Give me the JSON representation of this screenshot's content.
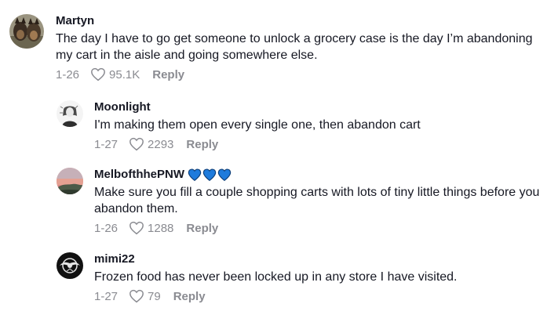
{
  "comments": [
    {
      "username": "Martyn",
      "text": "The day I have to go get someone to unlock a grocery case is the day I’m abandoning my cart in the aisle and going somewhere else.",
      "date": "1-26",
      "likes": "95.1K",
      "reply_label": "Reply",
      "avatar_icon": "photo-avatar-dogs"
    },
    {
      "username": "Moonlight",
      "text": "I'm making them open every single one, then abandon cart",
      "date": "1-27",
      "likes": "2293",
      "reply_label": "Reply",
      "avatar_icon": "sketch-avatar"
    },
    {
      "username": "MelbofthhePNW",
      "username_emoji": [
        "blue-heart-icon",
        "blue-heart-icon",
        "blue-heart-icon"
      ],
      "text": "Make sure you fill a couple shopping carts with lots of tiny little things before you abandon them.",
      "date": "1-26",
      "likes": "1288",
      "reply_label": "Reply",
      "avatar_icon": "sunset-avatar"
    },
    {
      "username": "mimi22",
      "text": "Frozen food has never been locked up in any store I have visited.",
      "date": "1-27",
      "likes": "79",
      "reply_label": "Reply",
      "avatar_icon": "dark-emblem-avatar"
    }
  ],
  "colors": {
    "text": "#161823",
    "muted": "#8a8b91",
    "heart_emoji": "#1e7bdc"
  }
}
